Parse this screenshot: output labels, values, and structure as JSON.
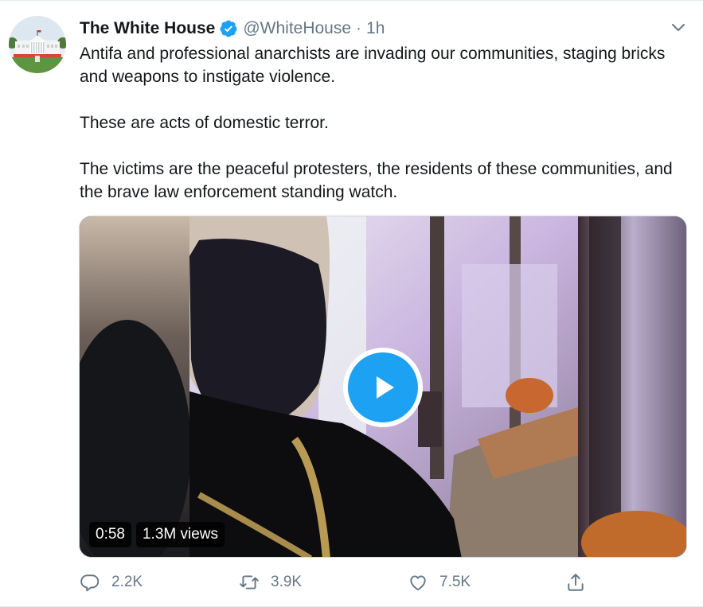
{
  "tweet": {
    "author_name": "The White House",
    "handle": "@WhiteHouse",
    "separator": "·",
    "time": "1h",
    "paragraphs": [
      "Antifa and professional anarchists are invading our communities, staging bricks and weapons to instigate violence.",
      "These are acts of domestic terror.",
      "The victims are the peaceful protesters, the residents of these communities, and the brave law enforcement standing watch."
    ],
    "video": {
      "duration": "0:58",
      "views": "1.3M views"
    },
    "actions": {
      "reply_count": "2.2K",
      "retweet_count": "3.9K",
      "like_count": "7.5K"
    }
  },
  "icons": {
    "avatar": "white-house-avatar",
    "verified": "verified-badge-icon",
    "caret": "chevron-down-icon",
    "play": "play-icon",
    "reply": "reply-icon",
    "retweet": "retweet-icon",
    "like": "heart-icon",
    "share": "share-icon"
  },
  "colors": {
    "accent": "#1da1f2",
    "secondary_text": "#657786",
    "primary_text": "#14171a"
  }
}
